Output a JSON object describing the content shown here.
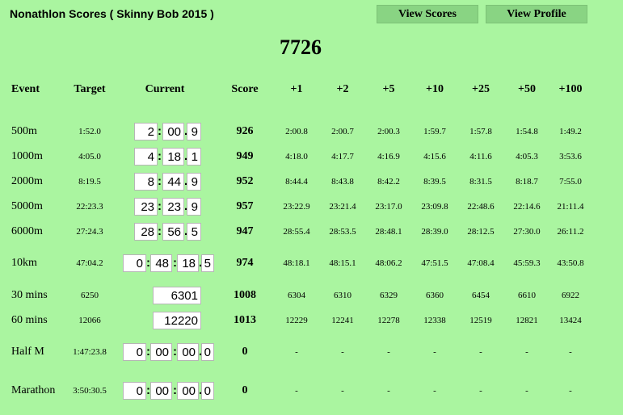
{
  "title": "Nonathlon Scores ( Skinny Bob 2015 )",
  "buttons": {
    "view_scores": "View  Scores",
    "view_profile": "View  Profile"
  },
  "total_score": "7726",
  "headers": {
    "event": "Event",
    "target": "Target",
    "current": "Current",
    "score": "Score",
    "increments": [
      "+1",
      "+2",
      "+5",
      "+10",
      "+25",
      "+50",
      "+100"
    ]
  },
  "separators": {
    "colon": ":",
    "dot": "."
  },
  "rows": [
    {
      "event": "500m",
      "target": "1:52.0",
      "current": [
        "2",
        "00",
        "9"
      ],
      "score": "926",
      "improvements": [
        "2:00.8",
        "2:00.7",
        "2:00.3",
        "1:59.7",
        "1:57.8",
        "1:54.8",
        "1:49.2"
      ]
    },
    {
      "event": "1000m",
      "target": "4:05.0",
      "current": [
        "4",
        "18",
        "1"
      ],
      "score": "949",
      "improvements": [
        "4:18.0",
        "4:17.7",
        "4:16.9",
        "4:15.6",
        "4:11.6",
        "4:05.3",
        "3:53.6"
      ]
    },
    {
      "event": "2000m",
      "target": "8:19.5",
      "current": [
        "8",
        "44",
        "9"
      ],
      "score": "952",
      "improvements": [
        "8:44.4",
        "8:43.8",
        "8:42.2",
        "8:39.5",
        "8:31.5",
        "8:18.7",
        "7:55.0"
      ]
    },
    {
      "event": "5000m",
      "target": "22:23.3",
      "current": [
        "23",
        "23",
        "9"
      ],
      "score": "957",
      "improvements": [
        "23:22.9",
        "23:21.4",
        "23:17.0",
        "23:09.8",
        "22:48.6",
        "22:14.6",
        "21:11.4"
      ]
    },
    {
      "event": "6000m",
      "target": "27:24.3",
      "current": [
        "28",
        "56",
        "5"
      ],
      "score": "947",
      "improvements": [
        "28:55.4",
        "28:53.5",
        "28:48.1",
        "28:39.0",
        "28:12.5",
        "27:30.0",
        "26:11.2"
      ]
    },
    {
      "event": "10km",
      "target": "47:04.2",
      "current": [
        "0",
        "48",
        "18",
        "5"
      ],
      "score": "974",
      "improvements": [
        "48:18.1",
        "48:15.1",
        "48:06.2",
        "47:51.5",
        "47:08.4",
        "45:59.3",
        "43:50.8"
      ]
    },
    {
      "event": "30 mins",
      "target": "6250",
      "current": [
        "6301"
      ],
      "score": "1008",
      "improvements": [
        "6304",
        "6310",
        "6329",
        "6360",
        "6454",
        "6610",
        "6922"
      ]
    },
    {
      "event": "60 mins",
      "target": "12066",
      "current": [
        "12220"
      ],
      "score": "1013",
      "improvements": [
        "12229",
        "12241",
        "12278",
        "12338",
        "12519",
        "12821",
        "13424"
      ]
    },
    {
      "event": "Half M",
      "target": "1:47:23.8",
      "current": [
        "0",
        "00",
        "00",
        "0"
      ],
      "score": "0",
      "improvements": [
        "-",
        "-",
        "-",
        "-",
        "-",
        "-",
        "-"
      ]
    },
    {
      "event": "Marathon",
      "target": "3:50:30.5",
      "current": [
        "0",
        "00",
        "00",
        "0"
      ],
      "score": "0",
      "improvements": [
        "-",
        "-",
        "-",
        "-",
        "-",
        "-",
        "-"
      ]
    }
  ]
}
